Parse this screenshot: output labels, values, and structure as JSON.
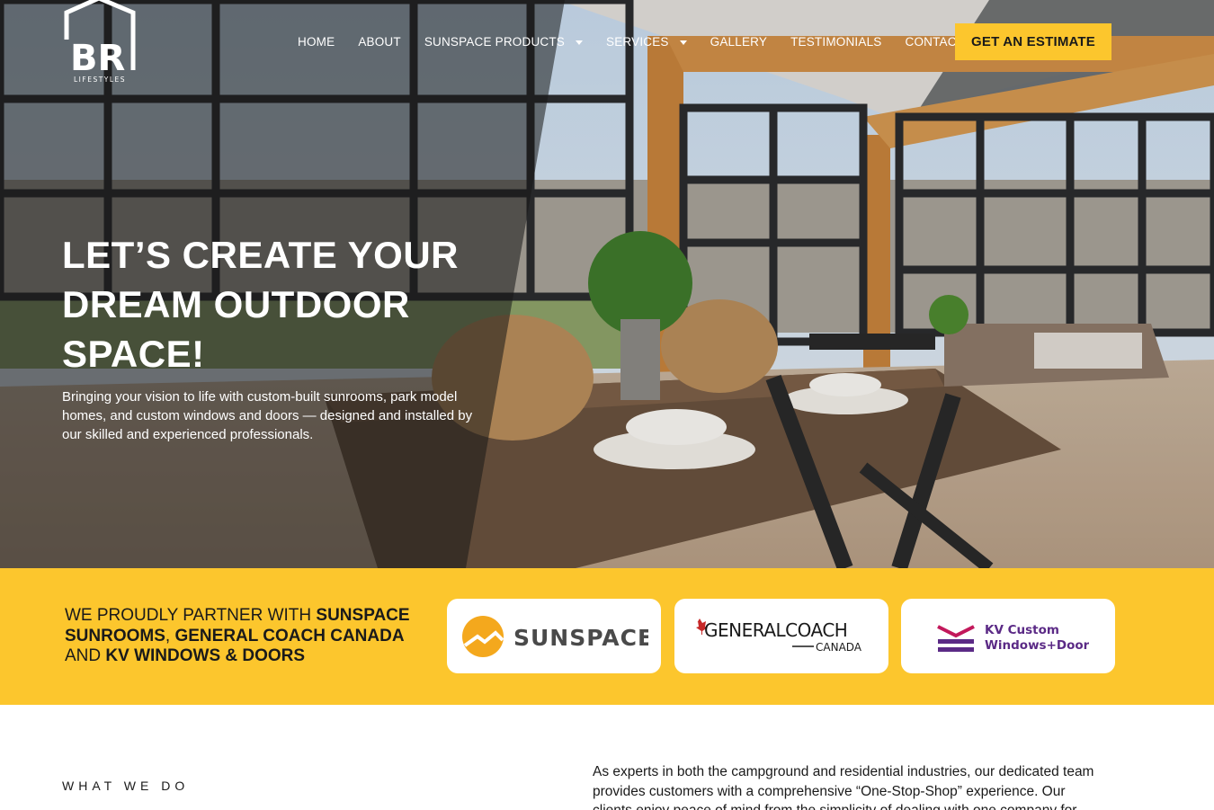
{
  "brand": {
    "logo_letters": "BR",
    "logo_sub": "LIFESTYLES"
  },
  "nav": {
    "items": [
      {
        "label": "HOME",
        "dropdown": false
      },
      {
        "label": "ABOUT",
        "dropdown": false
      },
      {
        "label": "SUNSPACE PRODUCTS",
        "dropdown": true
      },
      {
        "label": "SERVICES",
        "dropdown": true
      },
      {
        "label": "GALLERY",
        "dropdown": false
      },
      {
        "label": "TESTIMONIALS",
        "dropdown": false
      },
      {
        "label": "CONTACT US",
        "dropdown": false
      }
    ],
    "cta_label": "GET AN ESTIMATE"
  },
  "hero": {
    "title": "LET’S CREATE YOUR DREAM OUTDOOR SPACE!",
    "subtitle": "Bringing your vision to life with custom-built sunrooms, park model homes, and custom windows and doors — designed and installed by our skilled and experienced professionals."
  },
  "partners": {
    "intro_1": "WE PROUDLY PARTNER WITH ",
    "bold_1": "SUNSPACE SUNROOMS",
    "intro_2": ", ",
    "bold_2": "GENERAL COACH CANADA",
    "intro_3": " AND ",
    "bold_3": "KV WINDOWS & DOORS",
    "logos": {
      "sunspace": "SUNSPACE",
      "general_coach_main": "GENERALCOACH",
      "general_coach_sub": "CANADA",
      "kv_line1": "KV Custom",
      "kv_line2": "Windows+Doors"
    }
  },
  "what_we_do": {
    "label": "WHAT WE DO",
    "text": "As experts in both the campground and residential industries, our dedicated team provides customers with a comprehensive “One-Stop-Shop” experience. Our clients enjoy peace of mind from the simplicity of dealing with one company for multiple"
  },
  "colors": {
    "accent_yellow": "#fcc62d",
    "text_dark": "#1a1a1a",
    "white": "#ffffff",
    "kv_purple": "#5b2a86",
    "kv_pink": "#c2185b"
  }
}
